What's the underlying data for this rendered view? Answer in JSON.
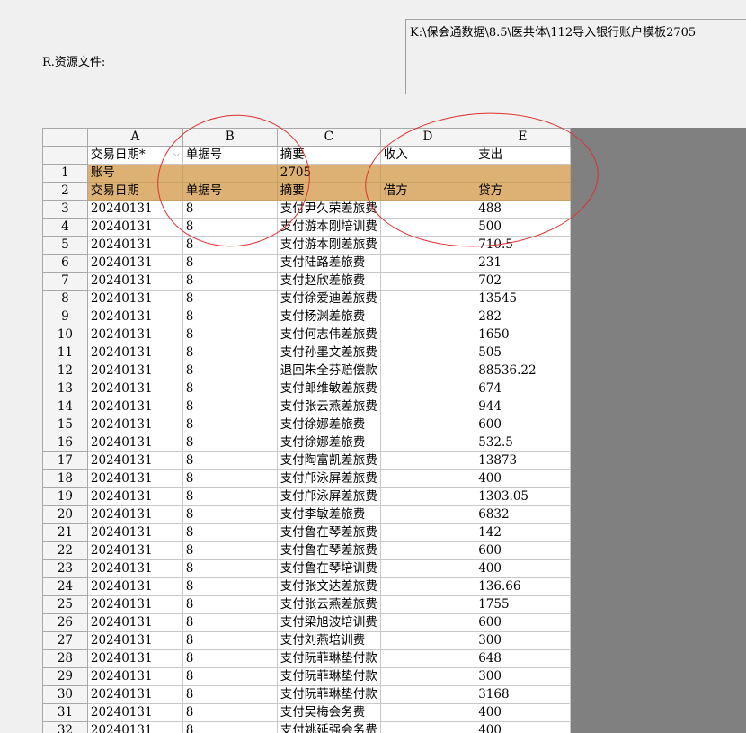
{
  "source": {
    "label": "R.资源文件:",
    "path": "K:\\保会通数据\\8.5\\医共体\\112导入银行账户模板2705"
  },
  "columns": [
    "A",
    "B",
    "C",
    "D",
    "E"
  ],
  "field_row": [
    "交易日期*",
    "单据号",
    "摘要",
    "收入",
    "支出"
  ],
  "field_row_dropdown": "⌵",
  "rows": [
    {
      "num": "1",
      "cells": [
        "账号",
        "",
        "2705",
        "",
        ""
      ]
    },
    {
      "num": "2",
      "cells": [
        "交易日期",
        "单据号",
        "摘要",
        "借方",
        "贷方"
      ]
    },
    {
      "num": "3",
      "cells": [
        "20240131",
        "8",
        "支付尹久荣差旅费",
        "",
        "488"
      ]
    },
    {
      "num": "4",
      "cells": [
        "20240131",
        "8",
        "支付游本刚培训费",
        "",
        "500"
      ]
    },
    {
      "num": "5",
      "cells": [
        "20240131",
        "8",
        "支付游本刚差旅费",
        "",
        "710.5"
      ]
    },
    {
      "num": "6",
      "cells": [
        "20240131",
        "8",
        "支付陆路差旅费",
        "",
        "231"
      ]
    },
    {
      "num": "7",
      "cells": [
        "20240131",
        "8",
        "支付赵欣差旅费",
        "",
        "702"
      ]
    },
    {
      "num": "8",
      "cells": [
        "20240131",
        "8",
        "支付徐爱迪差旅费",
        "",
        "13545"
      ]
    },
    {
      "num": "9",
      "cells": [
        "20240131",
        "8",
        "支付杨渊差旅费",
        "",
        "282"
      ]
    },
    {
      "num": "10",
      "cells": [
        "20240131",
        "8",
        "支付何志伟差旅费",
        "",
        "1650"
      ]
    },
    {
      "num": "11",
      "cells": [
        "20240131",
        "8",
        "支付孙墨文差旅费",
        "",
        "505"
      ]
    },
    {
      "num": "12",
      "cells": [
        "20240131",
        "8",
        "退回朱全芬赔偿款",
        "",
        "88536.22"
      ]
    },
    {
      "num": "13",
      "cells": [
        "20240131",
        "8",
        "支付郎维敏差旅费",
        "",
        "674"
      ]
    },
    {
      "num": "14",
      "cells": [
        "20240131",
        "8",
        "支付张云燕差旅费",
        "",
        "944"
      ]
    },
    {
      "num": "15",
      "cells": [
        "20240131",
        "8",
        "支付徐娜差旅费",
        "",
        "600"
      ]
    },
    {
      "num": "16",
      "cells": [
        "20240131",
        "8",
        "支付徐娜差旅费",
        "",
        "532.5"
      ]
    },
    {
      "num": "17",
      "cells": [
        "20240131",
        "8",
        "支付陶富凯差旅费",
        "",
        "13873"
      ]
    },
    {
      "num": "18",
      "cells": [
        "20240131",
        "8",
        "支付邝泳屏差旅费",
        "",
        "400"
      ]
    },
    {
      "num": "19",
      "cells": [
        "20240131",
        "8",
        "支付邝泳屏差旅费",
        "",
        "1303.05"
      ]
    },
    {
      "num": "20",
      "cells": [
        "20240131",
        "8",
        "支付李敏差旅费",
        "",
        "6832"
      ]
    },
    {
      "num": "21",
      "cells": [
        "20240131",
        "8",
        "支付鲁在琴差旅费",
        "",
        "142"
      ]
    },
    {
      "num": "22",
      "cells": [
        "20240131",
        "8",
        "支付鲁在琴差旅费",
        "",
        "600"
      ]
    },
    {
      "num": "23",
      "cells": [
        "20240131",
        "8",
        "支付鲁在琴培训费",
        "",
        "400"
      ]
    },
    {
      "num": "24",
      "cells": [
        "20240131",
        "8",
        "支付张文达差旅费",
        "",
        "136.66"
      ]
    },
    {
      "num": "25",
      "cells": [
        "20240131",
        "8",
        "支付张云燕差旅费",
        "",
        "1755"
      ]
    },
    {
      "num": "26",
      "cells": [
        "20240131",
        "8",
        "支付梁旭波培训费",
        "",
        "600"
      ]
    },
    {
      "num": "27",
      "cells": [
        "20240131",
        "8",
        "支付刘燕培训费",
        "",
        "300"
      ]
    },
    {
      "num": "28",
      "cells": [
        "20240131",
        "8",
        "支付阮菲琳垫付款",
        "",
        "648"
      ]
    },
    {
      "num": "29",
      "cells": [
        "20240131",
        "8",
        "支付阮菲琳垫付款",
        "",
        "300"
      ]
    },
    {
      "num": "30",
      "cells": [
        "20240131",
        "8",
        "支付阮菲琳垫付款",
        "",
        "3168"
      ]
    },
    {
      "num": "31",
      "cells": [
        "20240131",
        "8",
        "支付吴梅会务费",
        "",
        "400"
      ]
    },
    {
      "num": "32",
      "cells": [
        "20240131",
        "8",
        "支付姚延强会务费",
        "",
        "400"
      ]
    }
  ],
  "colors": {
    "header_band": "#dcb173",
    "annotation": "#e03030",
    "empty_area": "#808080"
  }
}
